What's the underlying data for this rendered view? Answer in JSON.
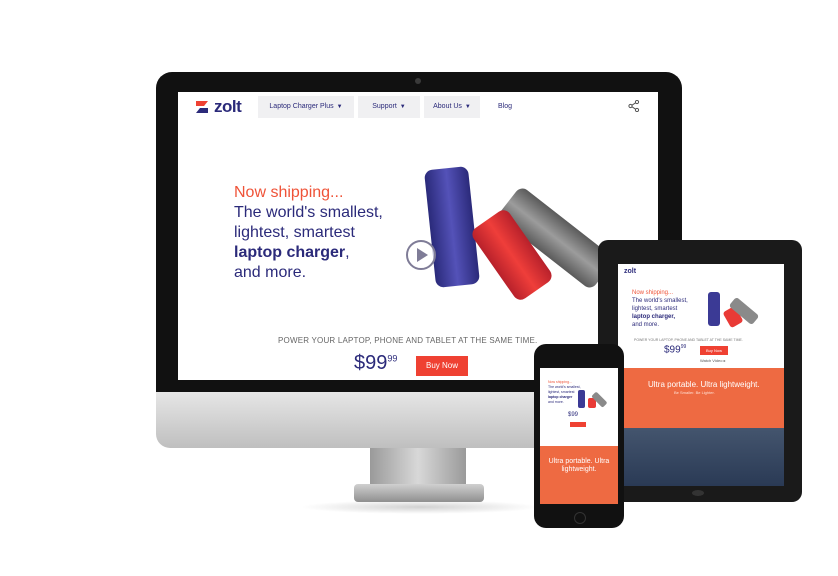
{
  "colors": {
    "brand_navy": "#2b2a7a",
    "accent_orange": "#ef5338",
    "buy_red": "#ef4132",
    "ultra_orange": "#ee6a42"
  },
  "desktop": {
    "logo_text": "zolt",
    "nav": [
      {
        "label": "Laptop Charger Plus",
        "caret": "▼"
      },
      {
        "label": "Support",
        "caret": "▼"
      },
      {
        "label": "About Us",
        "caret": "▼"
      }
    ],
    "nav_blog": "Blog",
    "hero": {
      "line1": "Now shipping...",
      "line2": "The world's smallest,",
      "line3": "lightest, smartest",
      "line4_bold": "laptop charger",
      "line4_rest": ",",
      "line5": "and more."
    },
    "tagline": "POWER YOUR LAPTOP, PHONE AND TABLET AT THE SAME TIME.",
    "price_main": "$99",
    "price_cents": "99",
    "buy_label": "Buy Now",
    "icons": {
      "logo": "zolt-logo-icon",
      "share": "share-icon",
      "play": "play-icon"
    }
  },
  "tablet": {
    "logo_text": "zolt",
    "hero": {
      "line1": "Now shipping...",
      "line2": "The world's smallest,",
      "line3": "lightest, smartest",
      "line4_bold": "laptop charger,",
      "line5": "and more."
    },
    "tagline": "POWER YOUR LAPTOP, PHONE AND TABLET AT THE SAME TIME.",
    "price_main": "$99",
    "price_cents": "99",
    "buy_label": "Buy Now",
    "watch_label": "Watch Video ▸",
    "ultra": "Ultra portable. Ultra lightweight.",
    "ultra_sub": "Be Smaller. Be Lighter."
  },
  "phone": {
    "hero": {
      "line1": "Now shipping...",
      "line2": "The world's smallest,",
      "line3": "lightest, smartest",
      "line4_bold": "laptop charger",
      "line5": "and more."
    },
    "price": "$99",
    "ultra": "Ultra portable. Ultra lightweight."
  }
}
